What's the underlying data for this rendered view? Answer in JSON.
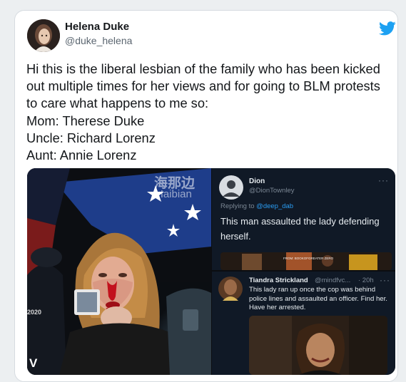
{
  "tweet": {
    "display_name": "Helena Duke",
    "handle": "@duke_helena",
    "text": "Hi this is the liberal lesbian of the family who has been kicked out multiple times for her views and for going to BLM protests to care what happens to me so:\nMom: Therese Duke\nUncle: Richard Lorenz\nAunt: Annie Lorenz"
  },
  "media": {
    "photo": {
      "watermark_cn": "海那边",
      "watermark_en": "Haibian",
      "corner_mark": "V",
      "date_mark": "2020"
    },
    "dion_reply": {
      "name": "Dion",
      "handle": "@DionTownley",
      "replying_prefix": "Replying to ",
      "replying_handle": "@deep_dab",
      "text": "This man assaulted the lady defending herself.",
      "strip_caption": "FROM: BOOKOFGREATER ZERO"
    },
    "tiandra_reply": {
      "name": "Tiandra Strickland",
      "handle": "@mindfvc...",
      "time": "· 20h",
      "text": "This lady ran up once the cop was behind police lines and assaulted an officer. Find her. Have her arrested."
    },
    "more_glyph": "···"
  },
  "colors": {
    "twitter_blue": "#1da1f2",
    "dark_panel": "#101926",
    "blood_red": "#c2121d"
  }
}
